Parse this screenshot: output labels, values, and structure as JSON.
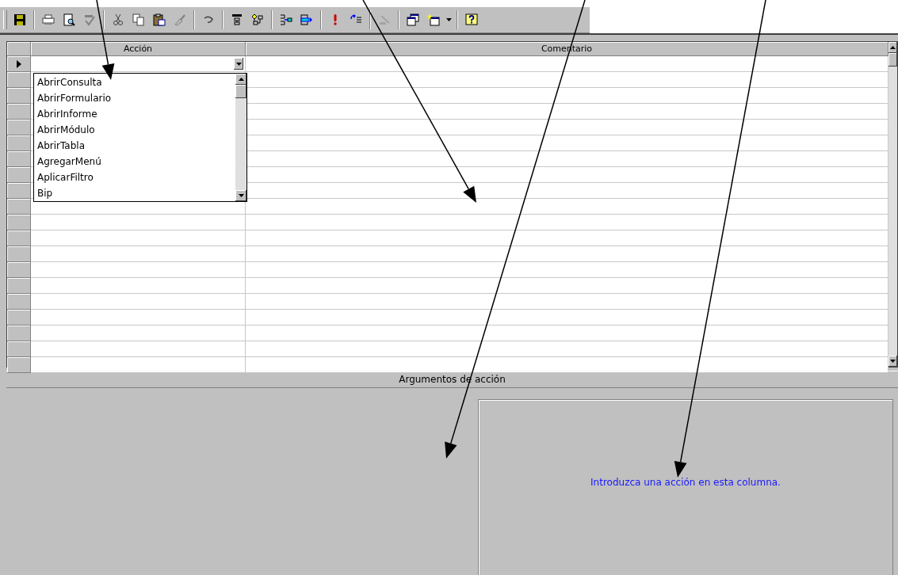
{
  "toolbar": {
    "groups": [
      [
        {
          "kind": "save",
          "disabled": false
        }
      ],
      [
        {
          "kind": "print",
          "disabled": false
        },
        {
          "kind": "preview",
          "disabled": false
        },
        {
          "kind": "spelling",
          "disabled": false
        }
      ],
      [
        {
          "kind": "cut",
          "disabled": false
        },
        {
          "kind": "copy",
          "disabled": false
        },
        {
          "kind": "paste",
          "disabled": false
        },
        {
          "kind": "painter",
          "disabled": false
        }
      ],
      [
        {
          "kind": "undo",
          "disabled": false
        }
      ],
      [
        {
          "kind": "names",
          "disabled": false
        },
        {
          "kind": "conditions",
          "disabled": false
        }
      ],
      [
        {
          "kind": "insert_rows",
          "disabled": false
        },
        {
          "kind": "delete_rows",
          "disabled": false
        }
      ],
      [
        {
          "kind": "run",
          "disabled": false
        },
        {
          "kind": "step",
          "disabled": false
        }
      ],
      [
        {
          "kind": "build",
          "disabled": true
        }
      ],
      [
        {
          "kind": "database",
          "disabled": false
        },
        {
          "kind": "new_object",
          "disabled": false
        }
      ],
      [
        {
          "kind": "help",
          "disabled": false
        }
      ]
    ]
  },
  "grid": {
    "columns": [
      "Acción",
      "Comentario"
    ],
    "rows": [
      {
        "selected": true
      },
      {
        "selected": false
      },
      {
        "selected": false
      },
      {
        "selected": false
      },
      {
        "selected": false
      },
      {
        "selected": false
      },
      {
        "selected": false
      },
      {
        "selected": false
      },
      {
        "selected": false
      },
      {
        "selected": false
      },
      {
        "selected": false
      },
      {
        "selected": false
      },
      {
        "selected": false
      },
      {
        "selected": false
      },
      {
        "selected": false
      },
      {
        "selected": false
      },
      {
        "selected": false
      },
      {
        "selected": false
      },
      {
        "selected": false
      },
      {
        "selected": false
      }
    ],
    "dropdown": {
      "items": [
        "AbrirConsulta",
        "AbrirFormulario",
        "AbrirInforme",
        "AbrirMódulo",
        "AbrirTabla",
        "AgregarMenú",
        "AplicarFiltro",
        "Bip"
      ]
    }
  },
  "arguments": {
    "title": "Argumentos de acción",
    "hint": "Introduzca una acción en esta columna."
  }
}
